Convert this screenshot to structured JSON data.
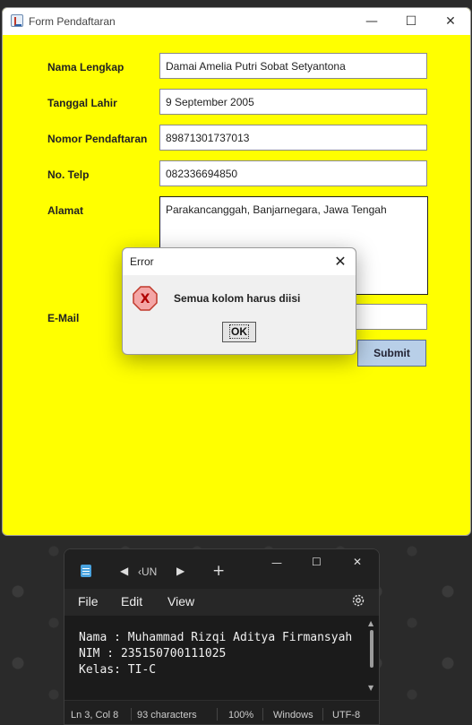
{
  "form": {
    "title": "Form Pendaftaran",
    "controls": {
      "minimize": "—",
      "maximize": "☐",
      "close": "✕"
    },
    "fields": [
      {
        "label": "Nama Lengkap",
        "value": "Damai Amelia Putri Sobat Setyantona"
      },
      {
        "label": "Tanggal Lahir",
        "value": "9 September 2005"
      },
      {
        "label": "Nomor Pendaftaran",
        "value": "89871301737013"
      },
      {
        "label": "No. Telp",
        "value": "082336694850"
      }
    ],
    "alamat": {
      "label": "Alamat",
      "value": "Parakancanggah, Banjarnegara, Jawa Tengah"
    },
    "email": {
      "label": "E-Mail",
      "value": ""
    },
    "submit_label": "Submit",
    "background_color": "#ffff00"
  },
  "dialog": {
    "title": "Error",
    "close": "✕",
    "message": "Semua kolom harus diisi",
    "icon": "error-x-icon",
    "icon_text": "X",
    "ok_label": "OK"
  },
  "notepad": {
    "tab_name": "‹UN",
    "menu": {
      "file": "File",
      "edit": "Edit",
      "view": "View"
    },
    "controls": {
      "minimize": "—",
      "maximize": "☐",
      "close": "✕"
    },
    "lines": [
      "Nama : Muhammad Rizqi Aditya Firmansyah",
      "NIM : 235150700111025",
      "Kelas: TI-C"
    ],
    "status": {
      "position": "Ln 3, Col 8",
      "chars": "93 characters",
      "zoom": "100%",
      "eol": "Windows",
      "encoding": "UTF-8"
    }
  }
}
